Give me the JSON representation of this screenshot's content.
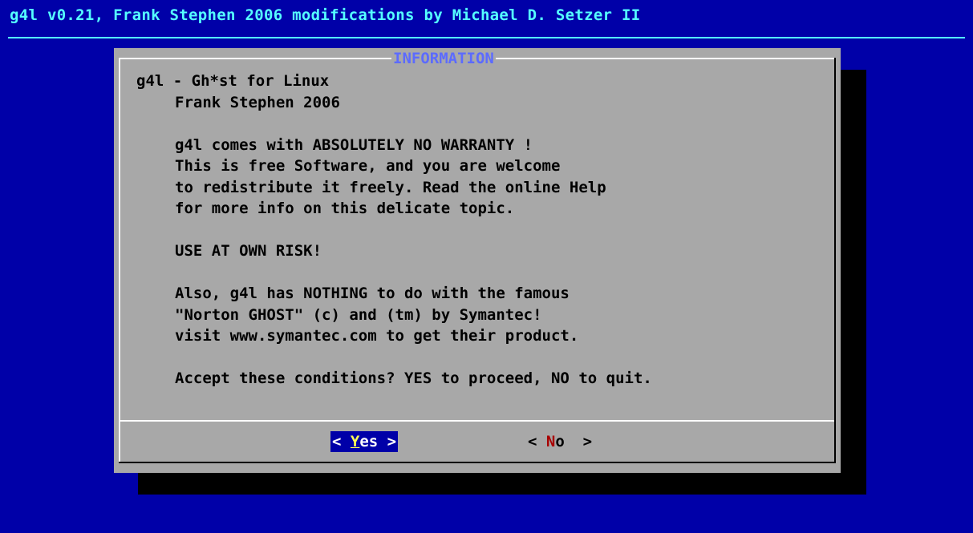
{
  "backtitle": "g4l v0.21, Frank Stephen 2006 modifications by Michael D. Setzer II",
  "dialog": {
    "title": "INFORMATION",
    "lines": [
      {
        "text": "g4l - Gh*st for Linux",
        "indent": false
      },
      {
        "text": "Frank Stephen 2006",
        "indent": true
      },
      {
        "text": "",
        "indent": true
      },
      {
        "text": "g4l comes with ABSOLUTELY NO WARRANTY !",
        "indent": true
      },
      {
        "text": "This is free Software, and you are welcome",
        "indent": true
      },
      {
        "text": "to redistribute it freely. Read the online Help",
        "indent": true
      },
      {
        "text": "for more info on this delicate topic.",
        "indent": true
      },
      {
        "text": "",
        "indent": true
      },
      {
        "text": "USE AT OWN RISK!",
        "indent": true
      },
      {
        "text": "",
        "indent": true
      },
      {
        "text": "Also, g4l has NOTHING to do with the famous",
        "indent": true
      },
      {
        "text": "\"Norton GHOST\" (c) and (tm) by Symantec!",
        "indent": true
      },
      {
        "text": "visit www.symantec.com to get their product.",
        "indent": true
      },
      {
        "text": "",
        "indent": true
      },
      {
        "text": "Accept these conditions? YES to proceed, NO to quit.",
        "indent": true
      }
    ],
    "buttons": {
      "yes": {
        "open": "< ",
        "hotkey": "Y",
        "rest": "es",
        "close": " >"
      },
      "no": {
        "open": "< ",
        "hotkey": "N",
        "rest": "o",
        "close": "  >"
      }
    }
  },
  "colors": {
    "background": "#0000a8",
    "backtitle": "#55ffff",
    "dialog_bg": "#a8a8a8",
    "dialog_title": "#5c6bff",
    "selected_button_bg": "#0000a8",
    "hotkey_selected": "#ffff55",
    "hotkey_unselected": "#a80000"
  }
}
